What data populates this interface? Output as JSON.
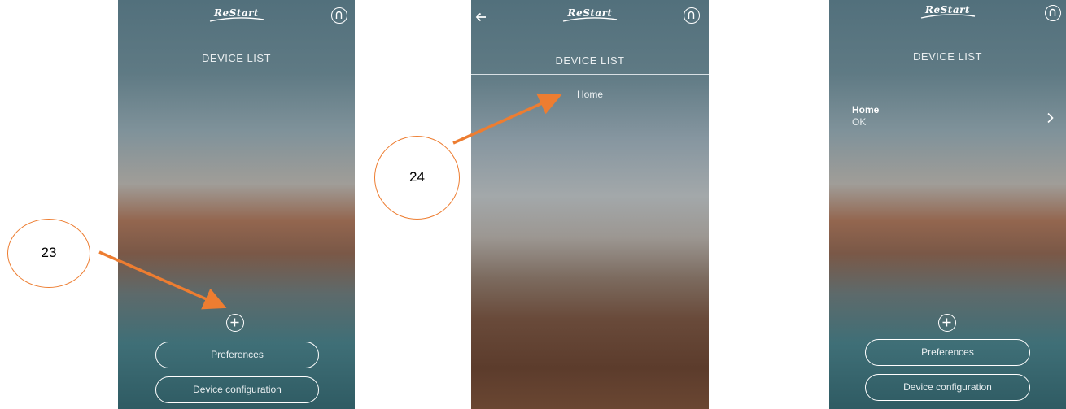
{
  "app": {
    "logo_text": "ReStart",
    "screen_title": "DEVICE LIST"
  },
  "screen_left": {
    "preferences_label": "Preferences",
    "device_config_label": "Device configuration"
  },
  "screen_middle": {
    "home_label": "Home"
  },
  "screen_right": {
    "device_name": "Home",
    "device_status": "OK",
    "preferences_label": "Preferences",
    "device_config_label": "Device configuration"
  },
  "annotations": {
    "callout_23": "23",
    "callout_24": "24",
    "accent_color": "#ed7d31"
  },
  "icons": [
    "profile-icon",
    "back-arrow-icon",
    "add-device-icon",
    "chevron-right-icon"
  ]
}
